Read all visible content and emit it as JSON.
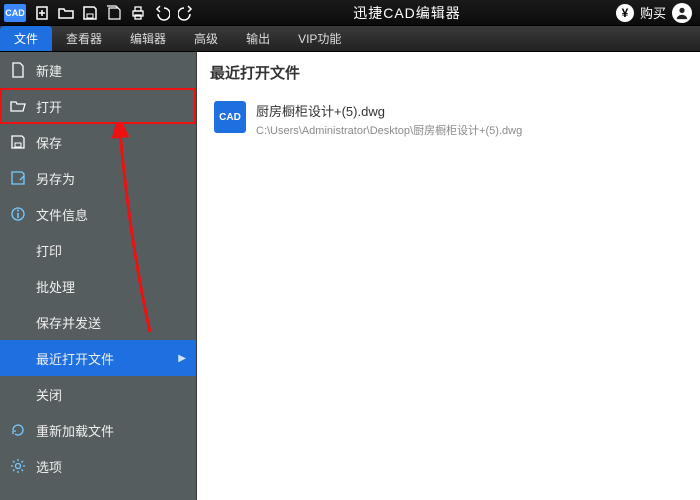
{
  "app": {
    "logo_text": "CAD",
    "title": "迅捷CAD编辑器",
    "buy_symbol": "¥",
    "buy_label": "购买"
  },
  "menubar": {
    "tabs": [
      {
        "label": "文件",
        "active": true
      },
      {
        "label": "查看器",
        "active": false
      },
      {
        "label": "编辑器",
        "active": false
      },
      {
        "label": "高级",
        "active": false
      },
      {
        "label": "输出",
        "active": false
      },
      {
        "label": "VIP功能",
        "active": false
      }
    ]
  },
  "sidebar": {
    "items": [
      {
        "label": "新建",
        "icon": "file",
        "highlight": false
      },
      {
        "label": "打开",
        "icon": "folder-open",
        "highlight": true
      },
      {
        "label": "保存",
        "icon": "save"
      },
      {
        "label": "另存为",
        "icon": "save-as"
      },
      {
        "label": "文件信息",
        "icon": "info"
      },
      {
        "label": "打印",
        "icon": "none"
      },
      {
        "label": "批处理",
        "icon": "none"
      },
      {
        "label": "保存并发送",
        "icon": "none"
      },
      {
        "label": "最近打开文件",
        "icon": "none",
        "selected": true,
        "chevron": true
      },
      {
        "label": "关闭",
        "icon": "none"
      },
      {
        "label": "重新加载文件",
        "icon": "reload"
      },
      {
        "label": "选项",
        "icon": "gear"
      }
    ]
  },
  "main": {
    "title": "最近打开文件",
    "recent": [
      {
        "thumb_label": "CAD",
        "name": "厨房橱柜设计+(5).dwg",
        "path": "C:\\Users\\Administrator\\Desktop\\厨房橱柜设计+(5).dwg"
      }
    ]
  }
}
